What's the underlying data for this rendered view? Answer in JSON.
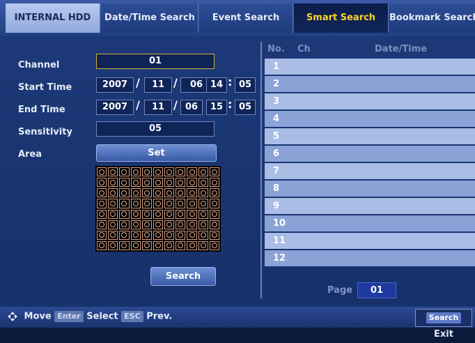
{
  "tabs": {
    "hdd": "INTERNAL HDD",
    "items": [
      "Date/Time Search",
      "Event Search",
      "Smart Search",
      "Bookmark Search"
    ],
    "active": "Smart Search"
  },
  "form": {
    "channel_label": "Channel",
    "channel_value": "01",
    "start_label": "Start Time",
    "start": {
      "year": "2007",
      "month": "11",
      "day": "06",
      "hour": "14",
      "minute": "05"
    },
    "end_label": "End Time",
    "end": {
      "year": "2007",
      "month": "11",
      "day": "06",
      "hour": "15",
      "minute": "05"
    },
    "sensitivity_label": "Sensitivity",
    "sensitivity_value": "05",
    "area_label": "Area",
    "set_label": "Set",
    "search_label": "Search"
  },
  "results": {
    "columns": [
      "No.",
      "Ch",
      "Date/Time"
    ],
    "rows": [
      "1",
      "2",
      "3",
      "4",
      "5",
      "6",
      "7",
      "8",
      "9",
      "10",
      "11",
      "12"
    ],
    "page_label": "Page",
    "page_value": "01"
  },
  "footer": {
    "move": "Move",
    "enter_key": "Enter",
    "select": "Select",
    "esc_key": "ESC",
    "prev": "Prev.",
    "search_key": "Search",
    "exit": "Exit"
  },
  "colors": {
    "active_tab_text": "#ffd22a",
    "background": "#1d3a79"
  }
}
